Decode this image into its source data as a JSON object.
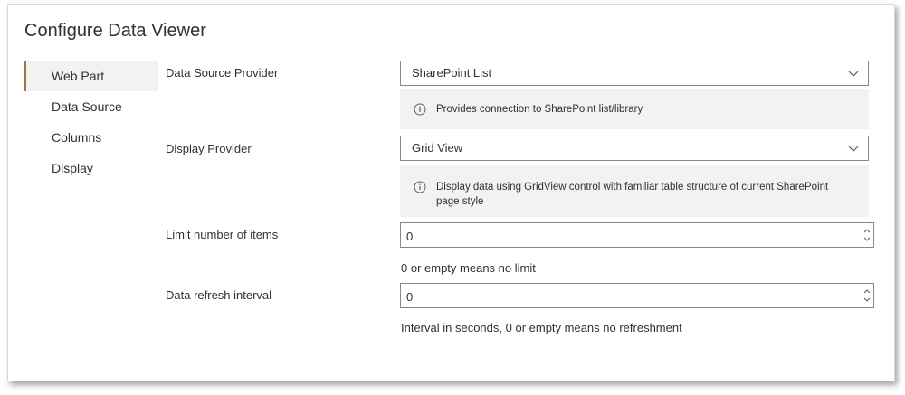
{
  "title": "Configure Data Viewer",
  "nav": {
    "items": [
      {
        "label": "Web Part",
        "active": true
      },
      {
        "label": "Data Source",
        "active": false
      },
      {
        "label": "Columns",
        "active": false
      },
      {
        "label": "Display",
        "active": false
      }
    ]
  },
  "form": {
    "data_source_provider": {
      "label": "Data Source Provider",
      "value": "SharePoint List",
      "info": "Provides connection to SharePoint list/library"
    },
    "display_provider": {
      "label": "Display Provider",
      "value": "Grid View",
      "info": "Display data using GridView control with familiar table structure of current SharePoint page style"
    },
    "limit_items": {
      "label": "Limit number of items",
      "value": "0",
      "hint": "0 or empty means no limit"
    },
    "refresh_interval": {
      "label": "Data refresh interval",
      "value": "0",
      "hint": "Interval in seconds, 0 or empty means no refreshment"
    }
  },
  "colors": {
    "accent": "#a4743f",
    "info_bg": "#f3f2f1",
    "border": "#8a8886"
  }
}
